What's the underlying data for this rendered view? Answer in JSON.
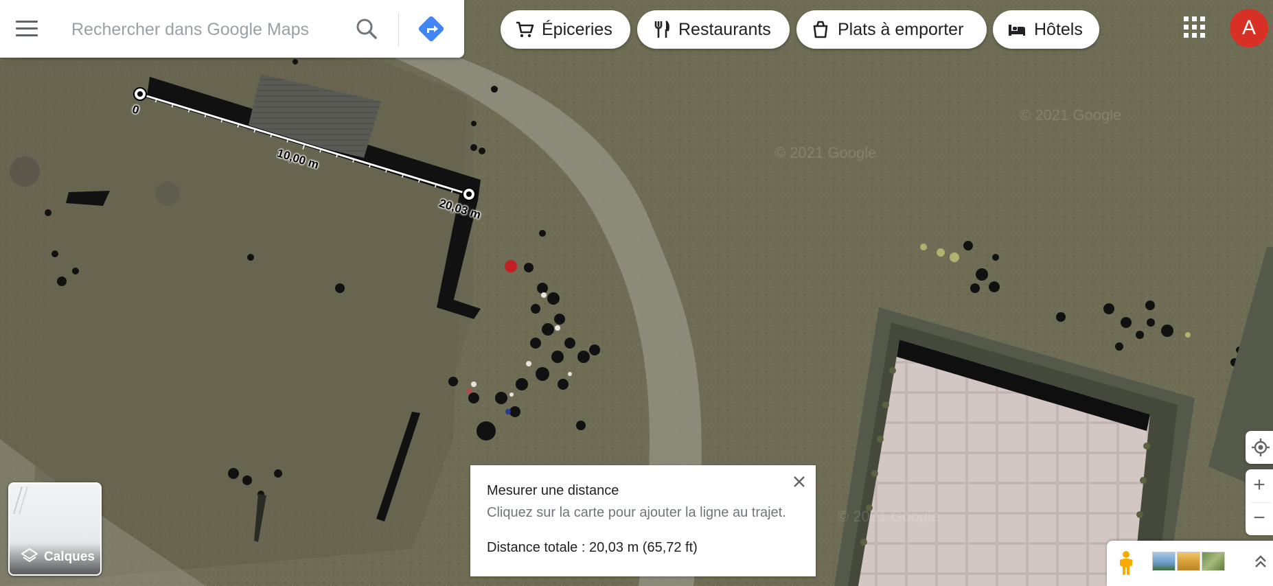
{
  "search": {
    "placeholder": "Rechercher dans Google Maps",
    "value": ""
  },
  "chips": [
    {
      "label": "Épiceries",
      "icon": "shopping-cart-icon"
    },
    {
      "label": "Restaurants",
      "icon": "fork-knife-icon"
    },
    {
      "label": "Plats à emporter",
      "icon": "takeout-bag-icon"
    },
    {
      "label": "Hôtels",
      "icon": "bed-icon"
    }
  ],
  "account": {
    "initial": "A",
    "color": "#d93025"
  },
  "colors": {
    "accent": "#1a73e8",
    "directions": "#4285f4",
    "avatar": "#d93025"
  },
  "measurement": {
    "start_label": "0",
    "mid_label": "10,00 m",
    "end_label": "20,03 m"
  },
  "measure_card": {
    "title": "Mesurer une distance",
    "hint": "Cliquez sur la carte pour ajouter la ligne au trajet.",
    "total": "Distance totale : 20,03 m (65,72 ft)"
  },
  "layers": {
    "label": "Calques",
    "icon": "layers-icon"
  },
  "map_controls": {
    "zoom_in": "+",
    "zoom_out": "−"
  },
  "watermark": "© 2021 Google"
}
